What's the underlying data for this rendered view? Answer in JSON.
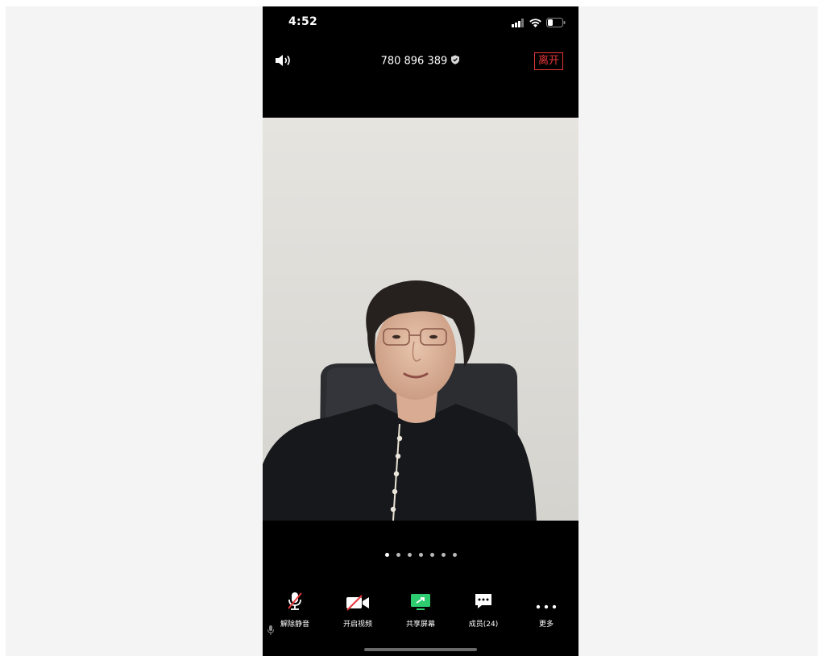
{
  "status_bar": {
    "time": "4:52",
    "icons": [
      "signal-icon",
      "wifi-icon",
      "battery-icon"
    ]
  },
  "header": {
    "speaker_icon": "speaker-icon",
    "meeting_id": "780 896 389",
    "shield_icon": "shield-icon",
    "leave_label": "离开"
  },
  "video": {
    "content": "participant-video"
  },
  "pager": {
    "count": 7,
    "active_index": 0
  },
  "toolbar": {
    "items": [
      {
        "label": "解除静音",
        "icon": "muted-mic-icon"
      },
      {
        "label": "开启视频",
        "icon": "video-off-icon"
      },
      {
        "label": "共享屏幕",
        "icon": "share-screen-icon"
      },
      {
        "label": "成员(24)",
        "icon": "participants-icon"
      },
      {
        "label": "更多",
        "icon": "more-icon"
      }
    ]
  },
  "colors": {
    "background": "#000000",
    "leave": "#e5373a",
    "share_green": "#2ecc71",
    "mute_red": "#e5373a"
  }
}
